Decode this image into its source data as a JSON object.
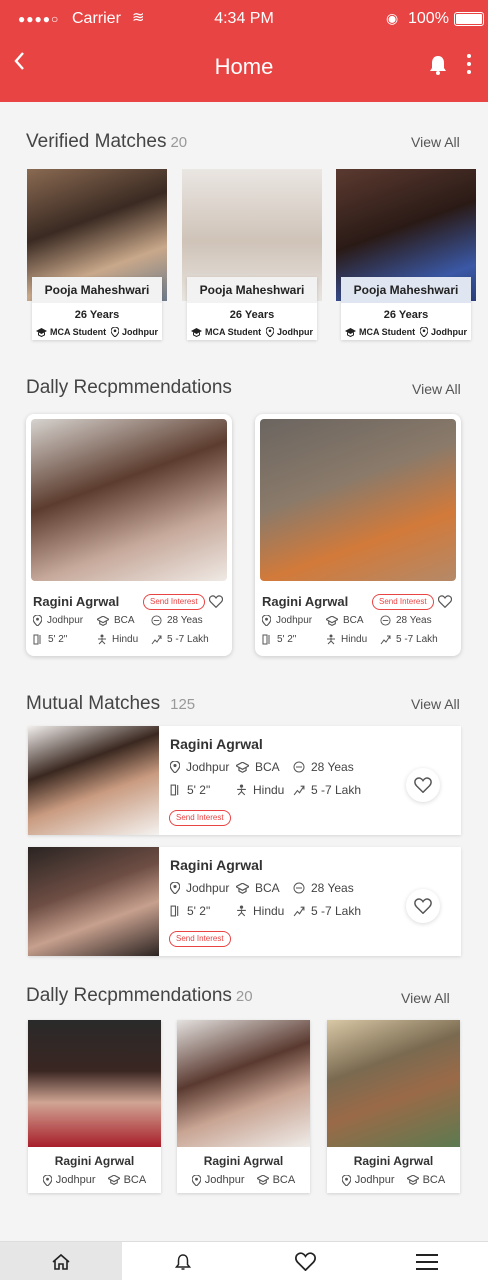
{
  "status_bar": {
    "carrier": "Carrier",
    "time": "4:34 PM",
    "battery": "100%"
  },
  "header": {
    "title": "Home"
  },
  "verified": {
    "title": "Verified Matches",
    "count": "20",
    "view_all": "View All",
    "cards": [
      {
        "name": "Pooja Maheshwari",
        "age": "26 Years",
        "education": "MCA Student",
        "city": "Jodhpur"
      },
      {
        "name": "Pooja Maheshwari",
        "age": "26 Years",
        "education": "MCA Student",
        "city": "Jodhpur"
      },
      {
        "name": "Pooja Maheshwari",
        "age": "26 Years",
        "education": "MCA Student",
        "city": "Jodhpur"
      }
    ]
  },
  "daily": {
    "title": "Dally Recpmmendations",
    "view_all": "View All",
    "cards": [
      {
        "name": "Ragini Agrwal",
        "interest": "Send Interest",
        "city": "Jodhpur",
        "education": "BCA",
        "age": "28 Yeas",
        "height": "5' 2\"",
        "religion": "Hindu",
        "income": "5 -7 Lakh"
      },
      {
        "name": "Ragini Agrwal",
        "interest": "Send Interest",
        "city": "Jodhpur",
        "education": "BCA",
        "age": "28 Yeas",
        "height": "5' 2\"",
        "religion": "Hindu",
        "income": "5 -7 Lakh"
      }
    ]
  },
  "mutual": {
    "title": "Mutual Matches",
    "count": "125",
    "view_all": "View All",
    "cards": [
      {
        "name": "Ragini Agrwal",
        "city": "Jodhpur",
        "education": "BCA",
        "age": "28 Yeas",
        "height": "5' 2\"",
        "religion": "Hindu",
        "income": "5 -7 Lakh",
        "interest": "Send Interest"
      },
      {
        "name": "Ragini Agrwal",
        "city": "Jodhpur",
        "education": "BCA",
        "age": "28 Yeas",
        "height": "5' 2\"",
        "religion": "Hindu",
        "income": "5 -7 Lakh",
        "interest": "Send Interest"
      }
    ]
  },
  "daily2": {
    "title": "Dally Recpmmendations",
    "count": "20",
    "view_all": "View All",
    "cards": [
      {
        "name": "Ragini Agrwal",
        "city": "Jodhpur",
        "education": "BCA"
      },
      {
        "name": "Ragini Agrwal",
        "city": "Jodhpur",
        "education": "BCA"
      },
      {
        "name": "Ragini Agrwal",
        "city": "Jodhpur",
        "education": "BCA"
      }
    ]
  },
  "tabbar": {
    "items": [
      "home-icon",
      "bell-icon",
      "heart-icon",
      "menu-icon"
    ],
    "active": "home-icon"
  },
  "colors": {
    "accent": "#e94444"
  }
}
